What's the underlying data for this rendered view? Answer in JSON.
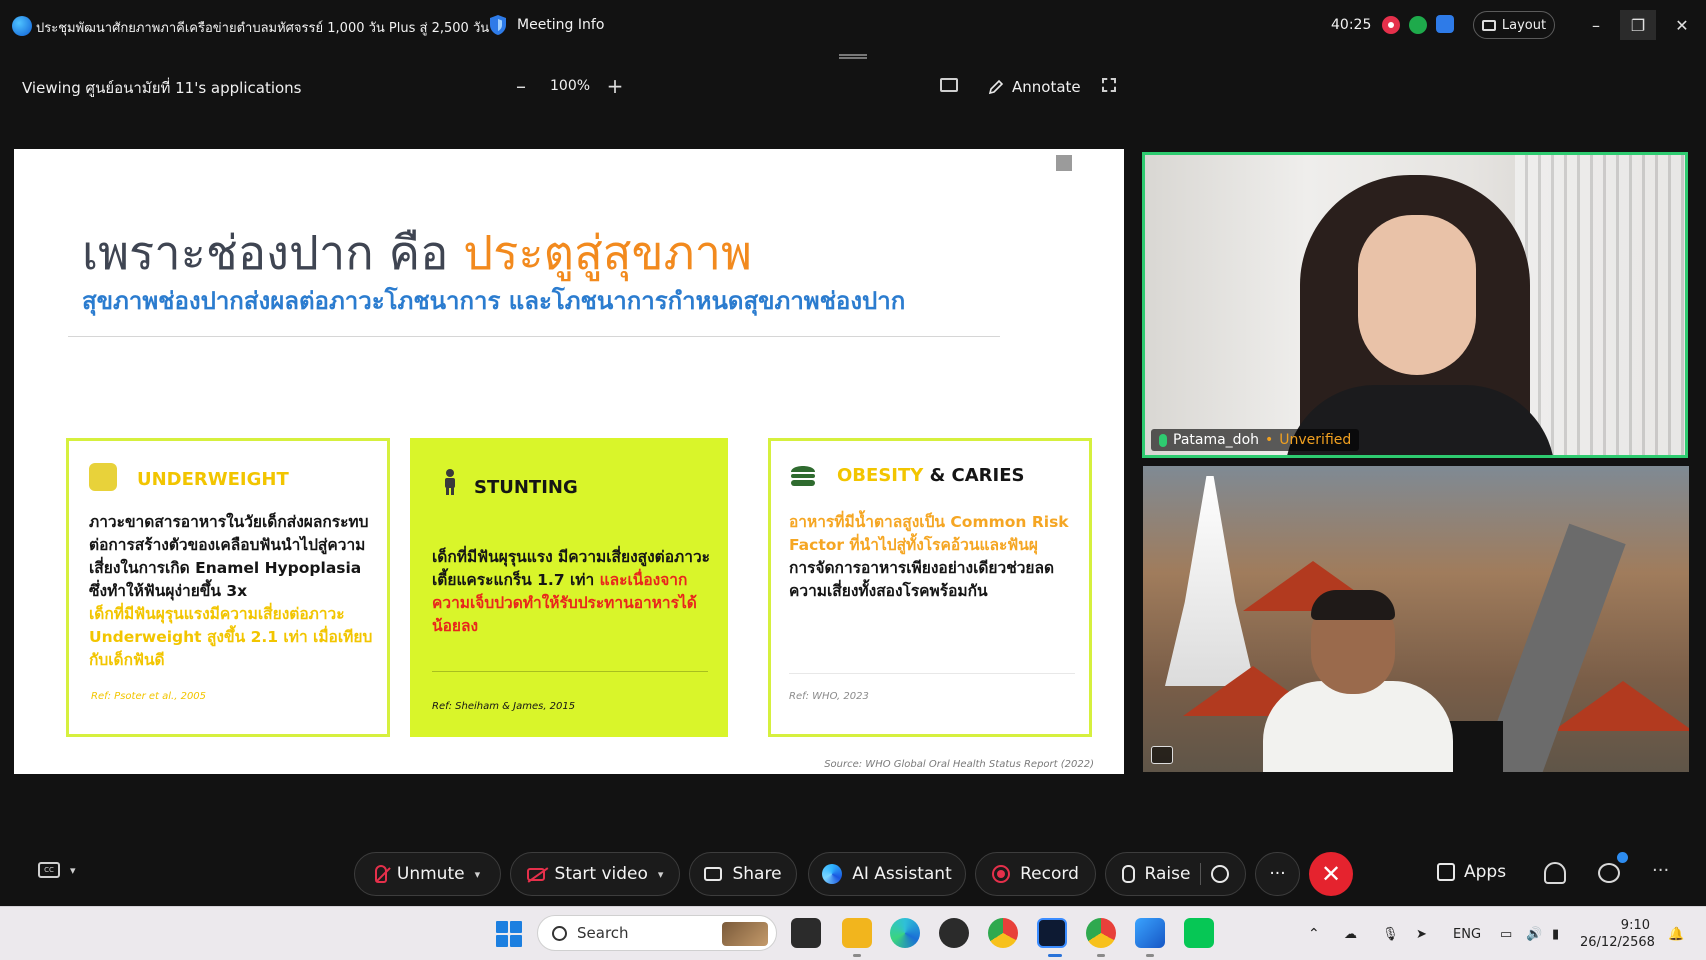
{
  "titlebar": {
    "meeting_title": "ประชุมพัฒนาศักยภาพภาคีเครือข่ายตำบลมหัศจรรย์ 1,000 วัน Plus สู่ 2,500 วัน",
    "meeting_info": "Meeting Info",
    "timer": "40:25",
    "layout_label": "Layout",
    "minimize": "–",
    "restore": "❐",
    "close": "✕"
  },
  "share_bar": {
    "viewing_label": "Viewing ศูนย์อนามัยที่ 11's applications",
    "zoom_out": "–",
    "zoom_level": "100%",
    "zoom_in": "+",
    "annotate_label": "Annotate"
  },
  "slide": {
    "title_main": "เพราะช่องปาก คือ ",
    "title_accent": "ประตูสู่สุขภาพ",
    "subtitle": "สุขภาพช่องปากส่งผลต่อภาวะโภชนาการ และโภชนาการกำหนดสุขภาพช่องปาก",
    "cards": [
      {
        "heading": "UNDERWEIGHT",
        "body": "ภาวะขาดสารอาหารในวัยเด็กส่งผลกระทบต่อการสร้างตัวของเคลือบฟันนำไปสู่ความเสี่ยงในการเกิด Enamel Hypoplasia ซึ่งทำให้ฟันผุง่ายขึ้น 3x",
        "highlight": "เด็กที่มีฟันผุรุนแรงมีความเสี่ยงต่อภาวะ Underweight สูงขึ้น 2.1 เท่า เมื่อเทียบกับเด็กฟันดี",
        "ref": "Ref: Psoter et al., 2005"
      },
      {
        "heading": "STUNTING",
        "body": "เด็กที่มีฟันผุรุนแรง มีความเสี่ยงสูงต่อภาวะเตี้ยแคระแกร็น 1.7 เท่า",
        "highlight": "และเนื่องจากความเจ็บปวดทำให้รับประทานอาหารได้น้อยลง",
        "ref": "Ref: Sheiham & James, 2015"
      },
      {
        "heading_accent": "OBESITY",
        "heading_rest": " & CARIES",
        "highlight": "อาหารที่มีน้ำตาลสูงเป็น Common Risk Factor ที่นำไปสู่ทั้งโรคอ้วนและฟันผุ",
        "body": "การจัดการอาหารเพียงอย่างเดียวช่วยลดความเสี่ยงทั้งสองโรคพร้อมกัน",
        "ref": "Ref: WHO, 2023"
      }
    ],
    "source": "Source: WHO Global Oral Health Status Report (2022)"
  },
  "participants": [
    {
      "name": "Patama_doh",
      "status": "Unverified"
    }
  ],
  "controls": {
    "unmute": "Unmute",
    "start_video": "Start video",
    "share": "Share",
    "ai_assistant": "AI Assistant",
    "record": "Record",
    "raise": "Raise",
    "more": "···",
    "end": "✕",
    "apps": "Apps",
    "more_right": "···"
  },
  "taskbar": {
    "search_placeholder": "Search",
    "language": "ENG",
    "time": "9:10",
    "date": "26/12/2568"
  },
  "colors": {
    "accent_orange": "#f28a1e",
    "subtitle_blue": "#2b7ccf",
    "card_lime": "#d9f52a",
    "end_red": "#e5232e",
    "active_speaker_green": "#2ecb70"
  }
}
